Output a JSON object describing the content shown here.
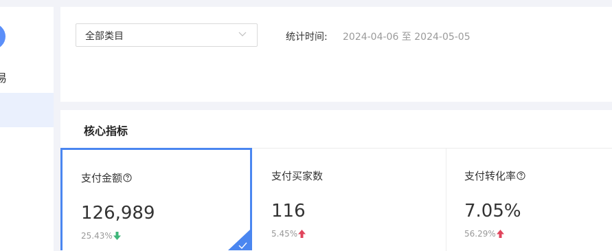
{
  "sidebar": {
    "partial_label": "易"
  },
  "filter": {
    "category_select": "全部类目",
    "stat_label": "统计时间:",
    "date_range": "2024-04-06 至 2024-05-05"
  },
  "metrics": {
    "title": "核心指标",
    "items": [
      {
        "label": "支付金额",
        "value": "126,989",
        "change": "25.43%",
        "direction": "down",
        "has_help": true,
        "selected": true
      },
      {
        "label": "支付买家数",
        "value": "116",
        "change": "5.45%",
        "direction": "up",
        "has_help": false,
        "selected": false
      },
      {
        "label": "支付转化率",
        "value": "7.05%",
        "change": "56.29%",
        "direction": "up",
        "has_help": true,
        "selected": false
      }
    ]
  },
  "colors": {
    "accent": "#4a86f0",
    "up": "#e0445c",
    "down": "#3fb67a",
    "page_bg": "#f2f3f8"
  },
  "icons": [
    "help-icon",
    "arrow-up-icon",
    "arrow-down-icon",
    "chevron-down-icon",
    "check-icon"
  ]
}
